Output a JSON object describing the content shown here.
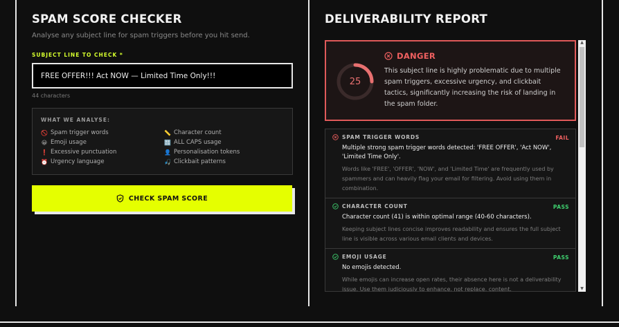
{
  "checker": {
    "title": "SPAM SCORE CHECKER",
    "subtitle": "Analyse any subject line for spam triggers before you hit send.",
    "field_label": "SUBJECT LINE TO CHECK *",
    "subject_value": "FREE OFFER!!! Act NOW — Limited Time Only!!!",
    "char_count": "44 characters",
    "analyse_title": "WHAT WE ANALYSE:",
    "analyse_items": [
      {
        "icon": "no-entry-icon",
        "glyph": "🚫",
        "label": "Spam trigger words"
      },
      {
        "icon": "ruler-icon",
        "glyph": "📏",
        "label": "Character count"
      },
      {
        "icon": "emoji-icon",
        "glyph": "😀",
        "label": "Emoji usage"
      },
      {
        "icon": "caps-icon",
        "glyph": "🔠",
        "label": "ALL CAPS usage"
      },
      {
        "icon": "exclamation-icon",
        "glyph": "❗",
        "label": "Excessive punctuation"
      },
      {
        "icon": "person-icon",
        "glyph": "👤",
        "label": "Personalisation tokens"
      },
      {
        "icon": "alarm-clock-icon",
        "glyph": "⏰",
        "label": "Urgency language"
      },
      {
        "icon": "fishing-icon",
        "glyph": "🎣",
        "label": "Clickbait patterns"
      }
    ],
    "button_label": "CHECK SPAM SCORE"
  },
  "report": {
    "title": "DELIVERABILITY REPORT",
    "score": "25",
    "score_fraction": 0.25,
    "verdict": "DANGER",
    "verdict_text": "This subject line is highly problematic due to multiple spam triggers, excessive urgency, and clickbait tactics, significantly increasing the risk of landing in the spam folder.",
    "results": [
      {
        "name": "SPAM TRIGGER WORDS",
        "status": "FAIL",
        "message": "Multiple strong spam trigger words detected: 'FREE OFFER', 'Act NOW', 'Limited Time Only'.",
        "note": "Words like 'FREE', 'OFFER', 'NOW', and 'Limited Time' are frequently used by spammers and can heavily flag your email for filtering. Avoid using them in combination."
      },
      {
        "name": "CHARACTER COUNT",
        "status": "PASS",
        "message": "Character count (41) is within optimal range (40-60 characters).",
        "note": "Keeping subject lines concise improves readability and ensures the full subject line is visible across various email clients and devices."
      },
      {
        "name": "EMOJI USAGE",
        "status": "PASS",
        "message": "No emojis detected.",
        "note": "While emojis can increase open rates, their absence here is not a deliverability issue. Use them judiciously to enhance, not replace, content."
      }
    ]
  },
  "colors": {
    "accent": "#e5ff00",
    "label_accent": "#d6ff2e",
    "danger": "#f06060",
    "pass": "#3ecf6e",
    "fail": "#f06060"
  }
}
